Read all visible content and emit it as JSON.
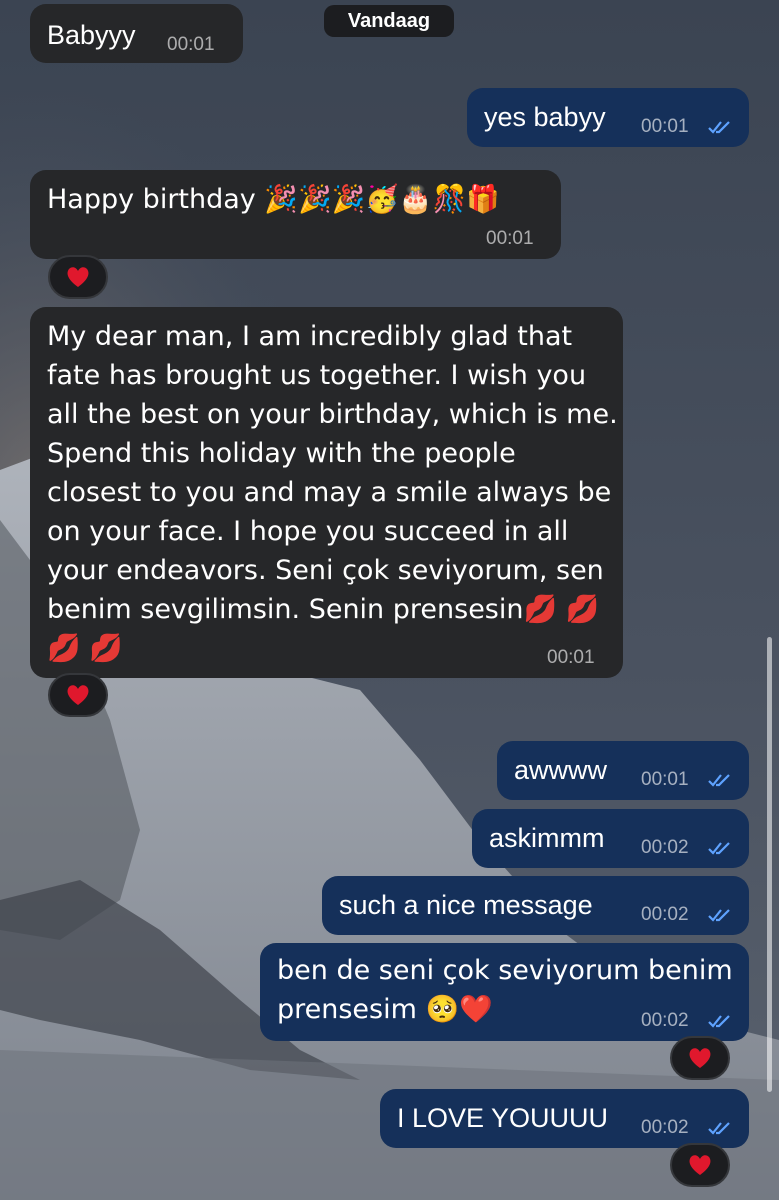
{
  "date_label": "Vandaag",
  "messages": [
    {
      "id": "m1",
      "dir": "in",
      "text": "Babyyy",
      "time": "00:01"
    },
    {
      "id": "m2",
      "dir": "out",
      "text": "yes babyy",
      "time": "00:01"
    },
    {
      "id": "m3",
      "dir": "in",
      "text": "Happy birthday 🎉🎉🎉🥳🎂🎊🎁",
      "time": "00:01",
      "reaction": "❤️"
    },
    {
      "id": "m4",
      "dir": "in",
      "text": "My dear man, I am incredibly glad that\nfate has brought us together. I wish you\nall the best on your birthday, which is me.\nSpend this holiday with the people\nclosest to you and may a smile always be\non your face. I hope you succeed in all\nyour endeavors. Seni çok seviyorum, sen\nbenim sevgilimsin. Senin prensesin💋 💋\n💋 💋",
      "time": "00:01",
      "reaction": "❤️"
    },
    {
      "id": "m5",
      "dir": "out",
      "text": "awwww",
      "time": "00:01"
    },
    {
      "id": "m6",
      "dir": "out",
      "text": "askimmm",
      "time": "00:02"
    },
    {
      "id": "m7",
      "dir": "out",
      "text": "such a nice message",
      "time": "00:02"
    },
    {
      "id": "m8",
      "dir": "out",
      "text": "ben de seni çok seviyorum benim\nprensesim 🥺❤️",
      "time": "00:02",
      "reaction": "❤️"
    },
    {
      "id": "m9",
      "dir": "out",
      "text": "I LOVE YOUUUU",
      "time": "00:02",
      "reaction": "❤️"
    }
  ],
  "colors": {
    "incoming_bubble": "#262729",
    "outgoing_bubble": "#15305a",
    "read_check": "#5ea2ff",
    "reaction_heart": "#e0182d"
  }
}
